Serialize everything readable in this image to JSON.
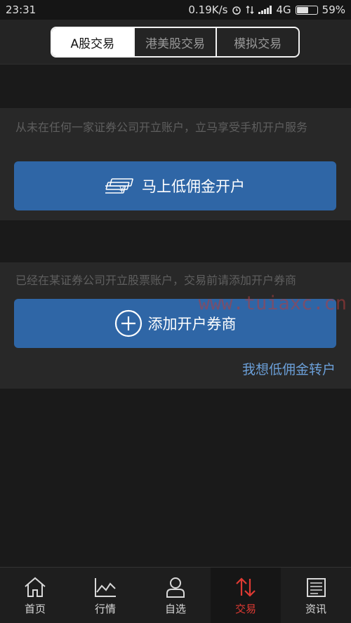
{
  "status_bar": {
    "time": "23:31",
    "speed": "0.19K/s",
    "network": "4G",
    "battery": "59%",
    "battery_level": 0.59
  },
  "top_tabs": [
    {
      "label": "A股交易",
      "active": true
    },
    {
      "label": "港美股交易",
      "active": false
    },
    {
      "label": "模拟交易",
      "active": false
    }
  ],
  "open_account": {
    "description": "从未在任何一家证券公司开立账户，立马享受手机开户服务",
    "button_label": "马上低佣金开户",
    "button_icon": "money-stack-icon"
  },
  "add_broker": {
    "description": "已经在某证券公司开立股票账户，交易前请添加开户券商",
    "button_label": "添加开户券商",
    "button_icon": "plus-circle-icon",
    "watermark": "www.tuiaxc.cn",
    "transfer_link": "我想低佣金转户"
  },
  "bottom_nav": [
    {
      "label": "首页",
      "icon": "home-icon",
      "active": false
    },
    {
      "label": "行情",
      "icon": "chart-icon",
      "active": false
    },
    {
      "label": "自选",
      "icon": "user-icon",
      "active": false
    },
    {
      "label": "交易",
      "icon": "trade-arrows-icon",
      "active": true
    },
    {
      "label": "资讯",
      "icon": "news-icon",
      "active": false
    }
  ],
  "colors": {
    "accent": "#2f66a6",
    "active_tab": "#e03a33",
    "link": "#6b9fd8"
  }
}
